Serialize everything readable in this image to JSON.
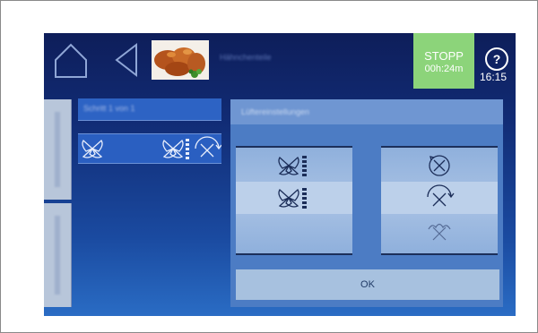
{
  "header": {
    "program_name": "Hähnchenteile",
    "stop_label": "STOPP",
    "remaining_time": "00h:24m",
    "clock": "16:15",
    "help_label": "?"
  },
  "sidebar": {
    "section_title": "Schritt 1 von 1"
  },
  "dialog": {
    "title": "Lüftereinstellungen",
    "ok_label": "OK"
  },
  "icons": {
    "home": "home-icon",
    "back": "back-arrow-icon",
    "fan_speed": "fan-speed-icon",
    "fan_direction": "fan-direction-icon"
  },
  "colors": {
    "stop_button": "#8cd47a",
    "screen_top": "#0e1e5a",
    "screen_bottom": "#2a6cc4"
  }
}
